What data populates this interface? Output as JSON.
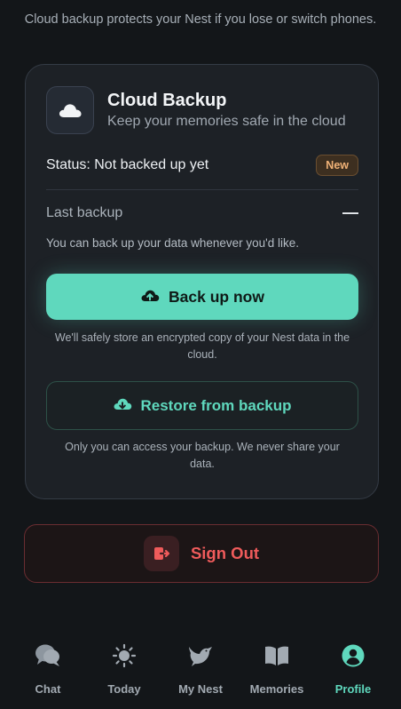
{
  "intro": "Cloud backup protects your Nest if you lose or switch phones.",
  "card": {
    "icon": "cloud-icon",
    "title": "Cloud Backup",
    "subtitle": "Keep your memories safe in the cloud",
    "status_text": "Status: Not backed up yet",
    "badge": "New",
    "last_backup_label": "Last backup",
    "last_backup_value": "—",
    "hint": "You can back up your data whenever you'd like.",
    "backup_button": {
      "label": "Back up now",
      "icon": "cloud-upload-icon"
    },
    "backup_note": "We'll safely store an encrypted copy of your Nest data in the cloud.",
    "restore_button": {
      "label": "Restore from backup",
      "icon": "cloud-download-icon"
    },
    "restore_note": "Only you can access your backup. We never share your data."
  },
  "signout": {
    "label": "Sign Out",
    "icon": "sign-out-icon"
  },
  "tabs": [
    {
      "label": "Chat",
      "icon": "chat-bubbles-icon",
      "active": false
    },
    {
      "label": "Today",
      "icon": "sun-icon",
      "active": false
    },
    {
      "label": "My Nest",
      "icon": "bird-icon",
      "active": false
    },
    {
      "label": "Memories",
      "icon": "book-icon",
      "active": false
    },
    {
      "label": "Profile",
      "icon": "profile-icon",
      "active": true
    }
  ],
  "colors": {
    "background": "#131619",
    "accent": "#5fd8bd",
    "danger": "#ef5b5b",
    "badge": "#f0b277"
  }
}
